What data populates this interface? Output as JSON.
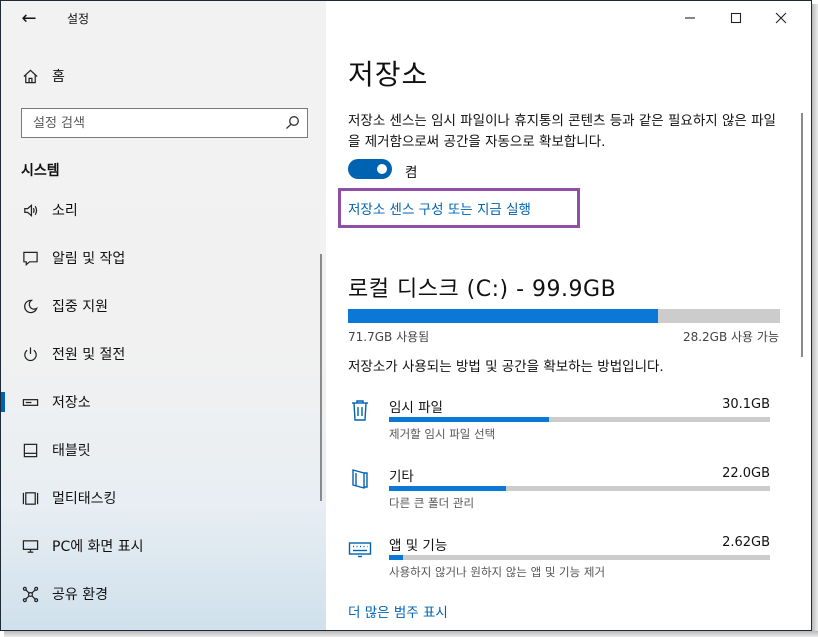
{
  "app": {
    "title": "설정",
    "back_icon": "back-arrow-icon"
  },
  "sidebar": {
    "home_label": "홈",
    "search_placeholder": "설정 검색",
    "section_title": "시스템",
    "items": [
      {
        "label": "소리",
        "icon": "speaker-icon"
      },
      {
        "label": "알림 및 작업",
        "icon": "notification-icon"
      },
      {
        "label": "집중 지원",
        "icon": "moon-icon"
      },
      {
        "label": "전원 및 절전",
        "icon": "power-icon"
      },
      {
        "label": "저장소",
        "icon": "storage-icon",
        "selected": true
      },
      {
        "label": "태블릿",
        "icon": "tablet-icon"
      },
      {
        "label": "멀티태스킹",
        "icon": "multitasking-icon"
      },
      {
        "label": "PC에 화면 표시",
        "icon": "projecting-icon"
      },
      {
        "label": "공유 환경",
        "icon": "shared-experiences-icon"
      }
    ]
  },
  "main": {
    "title": "저장소",
    "description": "저장소 센스는 임시 파일이나 휴지통의 콘텐츠 등과 같은 필요하지 않은 파일을 제거함으로써 공간을 자동으로 확보합니다.",
    "toggle": {
      "label": "켬",
      "on": true
    },
    "config_link": "저장소 센스 구성 또는 지금 실행",
    "disk": {
      "title": "로컬 디스크 (C:) - 99.9GB",
      "used_label": "71.7GB 사용됨",
      "free_label": "28.2GB 사용 가능",
      "used_fraction": 0.718
    },
    "subtext": "저장소가 사용되는 방법 및 공간을 확보하는 방법입니다.",
    "categories": [
      {
        "name": "임시 파일",
        "size": "30.1GB",
        "sub": "제거할 임시 파일 선택",
        "icon": "trash-icon",
        "fraction": 0.42
      },
      {
        "name": "기타",
        "size": "22.0GB",
        "sub": "다른 큰 폴더 관리",
        "icon": "folder-icon",
        "fraction": 0.307
      },
      {
        "name": "앱 및 기능",
        "size": "2.62GB",
        "sub": "사용하지 않거나 원하지 않는 앱 및 기능 제거",
        "icon": "keyboard-icon",
        "fraction": 0.037
      }
    ],
    "more_link": "더 많은 범주 표시"
  },
  "colors": {
    "accent": "#0063b1",
    "bar_fill": "#0a78d4",
    "bar_track": "#cccccc",
    "highlight_box": "#8e4fa5"
  }
}
